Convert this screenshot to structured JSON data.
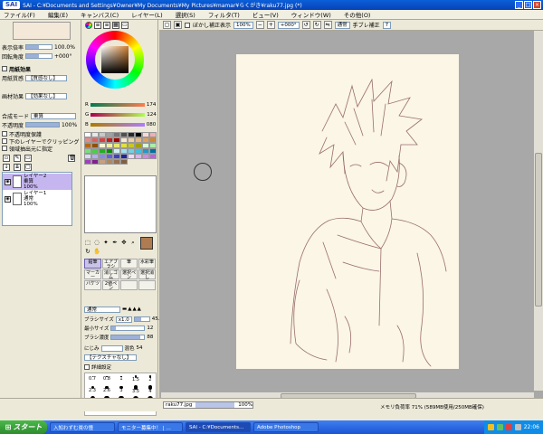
{
  "window": {
    "app_logo": "SAI",
    "title": "SAI - C:¥Documents and Settings¥Owner¥My Documents¥My Pictures¥mamar¥らくがき¥raku77.jpg (*)"
  },
  "menu": [
    "ファイル(F)",
    "編集(E)",
    "キャンバス(C)",
    "レイヤー(L)",
    "選択(S)",
    "フィルタ(T)",
    "ビュー(V)",
    "ウィンドウ(W)",
    "その他(O)"
  ],
  "left_panel": {
    "zoom_label": "表示倍率",
    "zoom_value": "100.0%",
    "rotate_label": "回転角度",
    "rotate_value": "+000°",
    "paper_effect_header": "用紙効果",
    "paper_texture_label": "用紙質感",
    "paper_texture_value": "【質感なし】",
    "paper_effect_label": "画材効果",
    "paper_effect_value": "【効果なし】",
    "blend_label": "合成モード",
    "blend_value": "乗算",
    "opacity_label": "不透明度",
    "opacity_value": "100%",
    "opacity_fill": 1.0,
    "checks": [
      "不透明度保護",
      "下のレイヤーでクリッピング",
      "領域抽出元に指定"
    ],
    "layers": [
      {
        "name": "レイヤー2",
        "mode": "乗算",
        "opacity": "100%",
        "selected": true
      },
      {
        "name": "レイヤー1",
        "mode": "通常",
        "opacity": "100%",
        "selected": false
      }
    ]
  },
  "color_panel": {
    "rgb": [
      {
        "label": "R",
        "value": "174"
      },
      {
        "label": "G",
        "value": "124"
      },
      {
        "label": "B",
        "value": "080"
      }
    ],
    "current_color": "#ae7c50",
    "swatch_colors": [
      "#ffffff",
      "#e8e8e8",
      "#c8c8c8",
      "#a0a0a0",
      "#787878",
      "#505050",
      "#282828",
      "#000000",
      "#f8d8d8",
      "#f0b0b0",
      "#e88888",
      "#e06060",
      "#d84040",
      "#c02020",
      "#a00000",
      "#f8e8d0",
      "#f0d0a8",
      "#e8b880",
      "#e0a058",
      "#d08830",
      "#b86810",
      "#905000",
      "#f8f8d0",
      "#f0f0a0",
      "#e8e870",
      "#e0e040",
      "#c8c820",
      "#a0a000",
      "#d8f8d8",
      "#a8f0a8",
      "#78e078",
      "#48d048",
      "#20b020",
      "#009000",
      "#d0f0f8",
      "#a0e0f0",
      "#70d0e8",
      "#40c0e0",
      "#2098c8",
      "#0070a0",
      "#d8d8f8",
      "#b0b0f0",
      "#8888e8",
      "#6060e0",
      "#4040c0",
      "#2020a0",
      "#f0d8f8",
      "#e0b0f0",
      "#d088e8",
      "#c060e0",
      "#a040c0",
      "#802090",
      "#c8a080",
      "#b08860",
      "#987050",
      "#806040"
    ]
  },
  "tools": {
    "brushes": [
      {
        "label": "鉛筆",
        "selected": true
      },
      {
        "label": "エアブラシ",
        "selected": false
      },
      {
        "label": "筆",
        "selected": false
      },
      {
        "label": "水彩筆",
        "selected": false
      },
      {
        "label": "マーカー",
        "selected": false
      },
      {
        "label": "消しゴム",
        "selected": false
      },
      {
        "label": "選択ペン",
        "selected": false
      },
      {
        "label": "選択消し",
        "selected": false
      },
      {
        "label": "バケツ",
        "selected": false
      },
      {
        "label": "2値ペン",
        "selected": false
      },
      {
        "label": "",
        "selected": false
      },
      {
        "label": "",
        "selected": false
      }
    ],
    "mode_value": "通常",
    "brush_size_label": "ブラシサイズ",
    "brush_size_mult": "x1.0",
    "brush_size_value": "45.5",
    "min_size_label": "最小サイズ",
    "min_size_value": "12",
    "density_label": "ブラシ濃度",
    "density_value": "88",
    "blur_label": "にじみ",
    "blur_value": "54",
    "texture_label": "【テクスチャなし】",
    "detail_label": "詳細設定",
    "dot_sizes": [
      "0.7",
      "0.8",
      "1",
      "1.5",
      "2",
      "2.3",
      "2.6",
      "3",
      "3.5",
      "4",
      "5",
      "6",
      "7",
      "8",
      "9"
    ]
  },
  "canvas_toolbar": {
    "stabilizer_label": "ぼかし補正表示",
    "zoom_value": "100%",
    "rotate_value": "+000°",
    "mode_value": "通常",
    "hand_label": "手ブレ補正",
    "hand_value": "7"
  },
  "statusbar": {
    "file_tab": "raku77.jpg",
    "file_zoom": "100%",
    "memory_text": "メモリ負荷率 71% (589MB使用/250MB確保)"
  },
  "taskbar": {
    "start_label": "スタート",
    "tasks": [
      "入知わずむ貧の憧",
      "モニター募集中！ | …",
      "SAI - C:¥Documents…",
      "Adobe Photoshop"
    ],
    "active_task": 2,
    "clock": "22:06"
  }
}
